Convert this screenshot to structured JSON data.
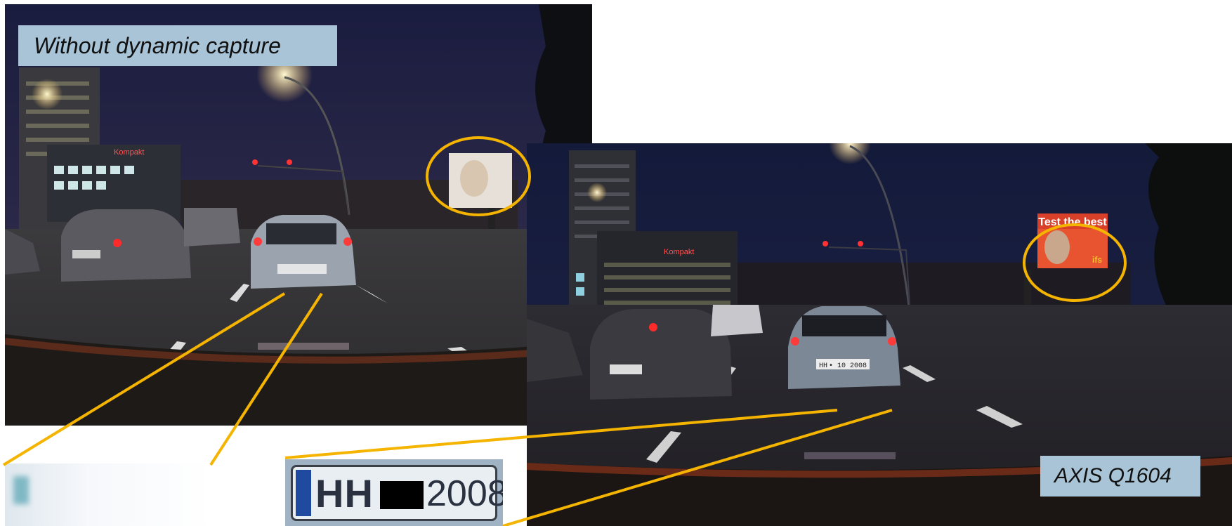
{
  "left_panel": {
    "caption": "Without dynamic capture"
  },
  "right_panel": {
    "caption": "AXIS Q1604",
    "plate_text": "HH • 10 2008",
    "billboard_text": "Test the best",
    "billboard_sub": "ifs"
  },
  "zoom_crops": {
    "plate_prefix": "HH",
    "plate_suffix": "2008"
  },
  "colors": {
    "callout": "#f4b400",
    "caption_bg": "#a8c4d6",
    "night_sky": "#1a1f3d"
  }
}
